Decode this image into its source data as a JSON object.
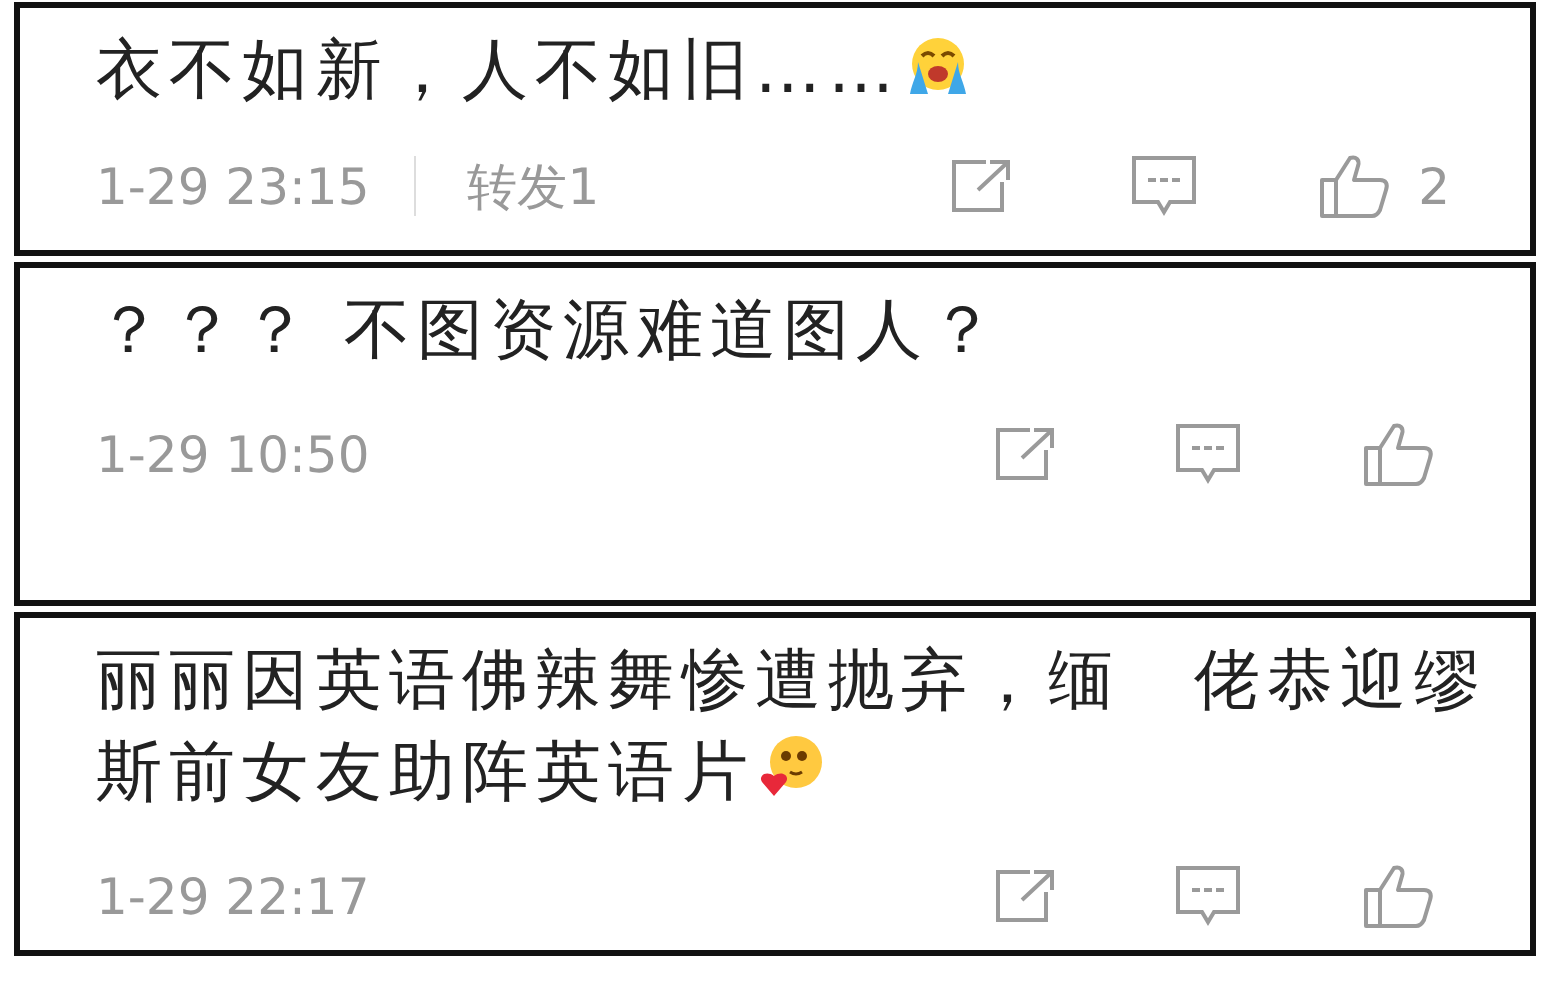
{
  "comments": [
    {
      "lines": [
        "衣不如新，人不如旧……"
      ],
      "kind": "crying-emoji",
      "time": "1-29 23:15",
      "repost": "转发1",
      "likes": "2"
    },
    {
      "lines": [
        "？？？ 不图资源难道图人？"
      ],
      "kind": "plain",
      "time": "1-29 10:50"
    },
    {
      "lines": [
        "丽丽因英语佛辣舞惨遭抛弃，缅　佬恭迎缪",
        "斯前女友助阵英语片"
      ],
      "kind": "blushing-emoji",
      "time": "1-29 22:17"
    }
  ]
}
